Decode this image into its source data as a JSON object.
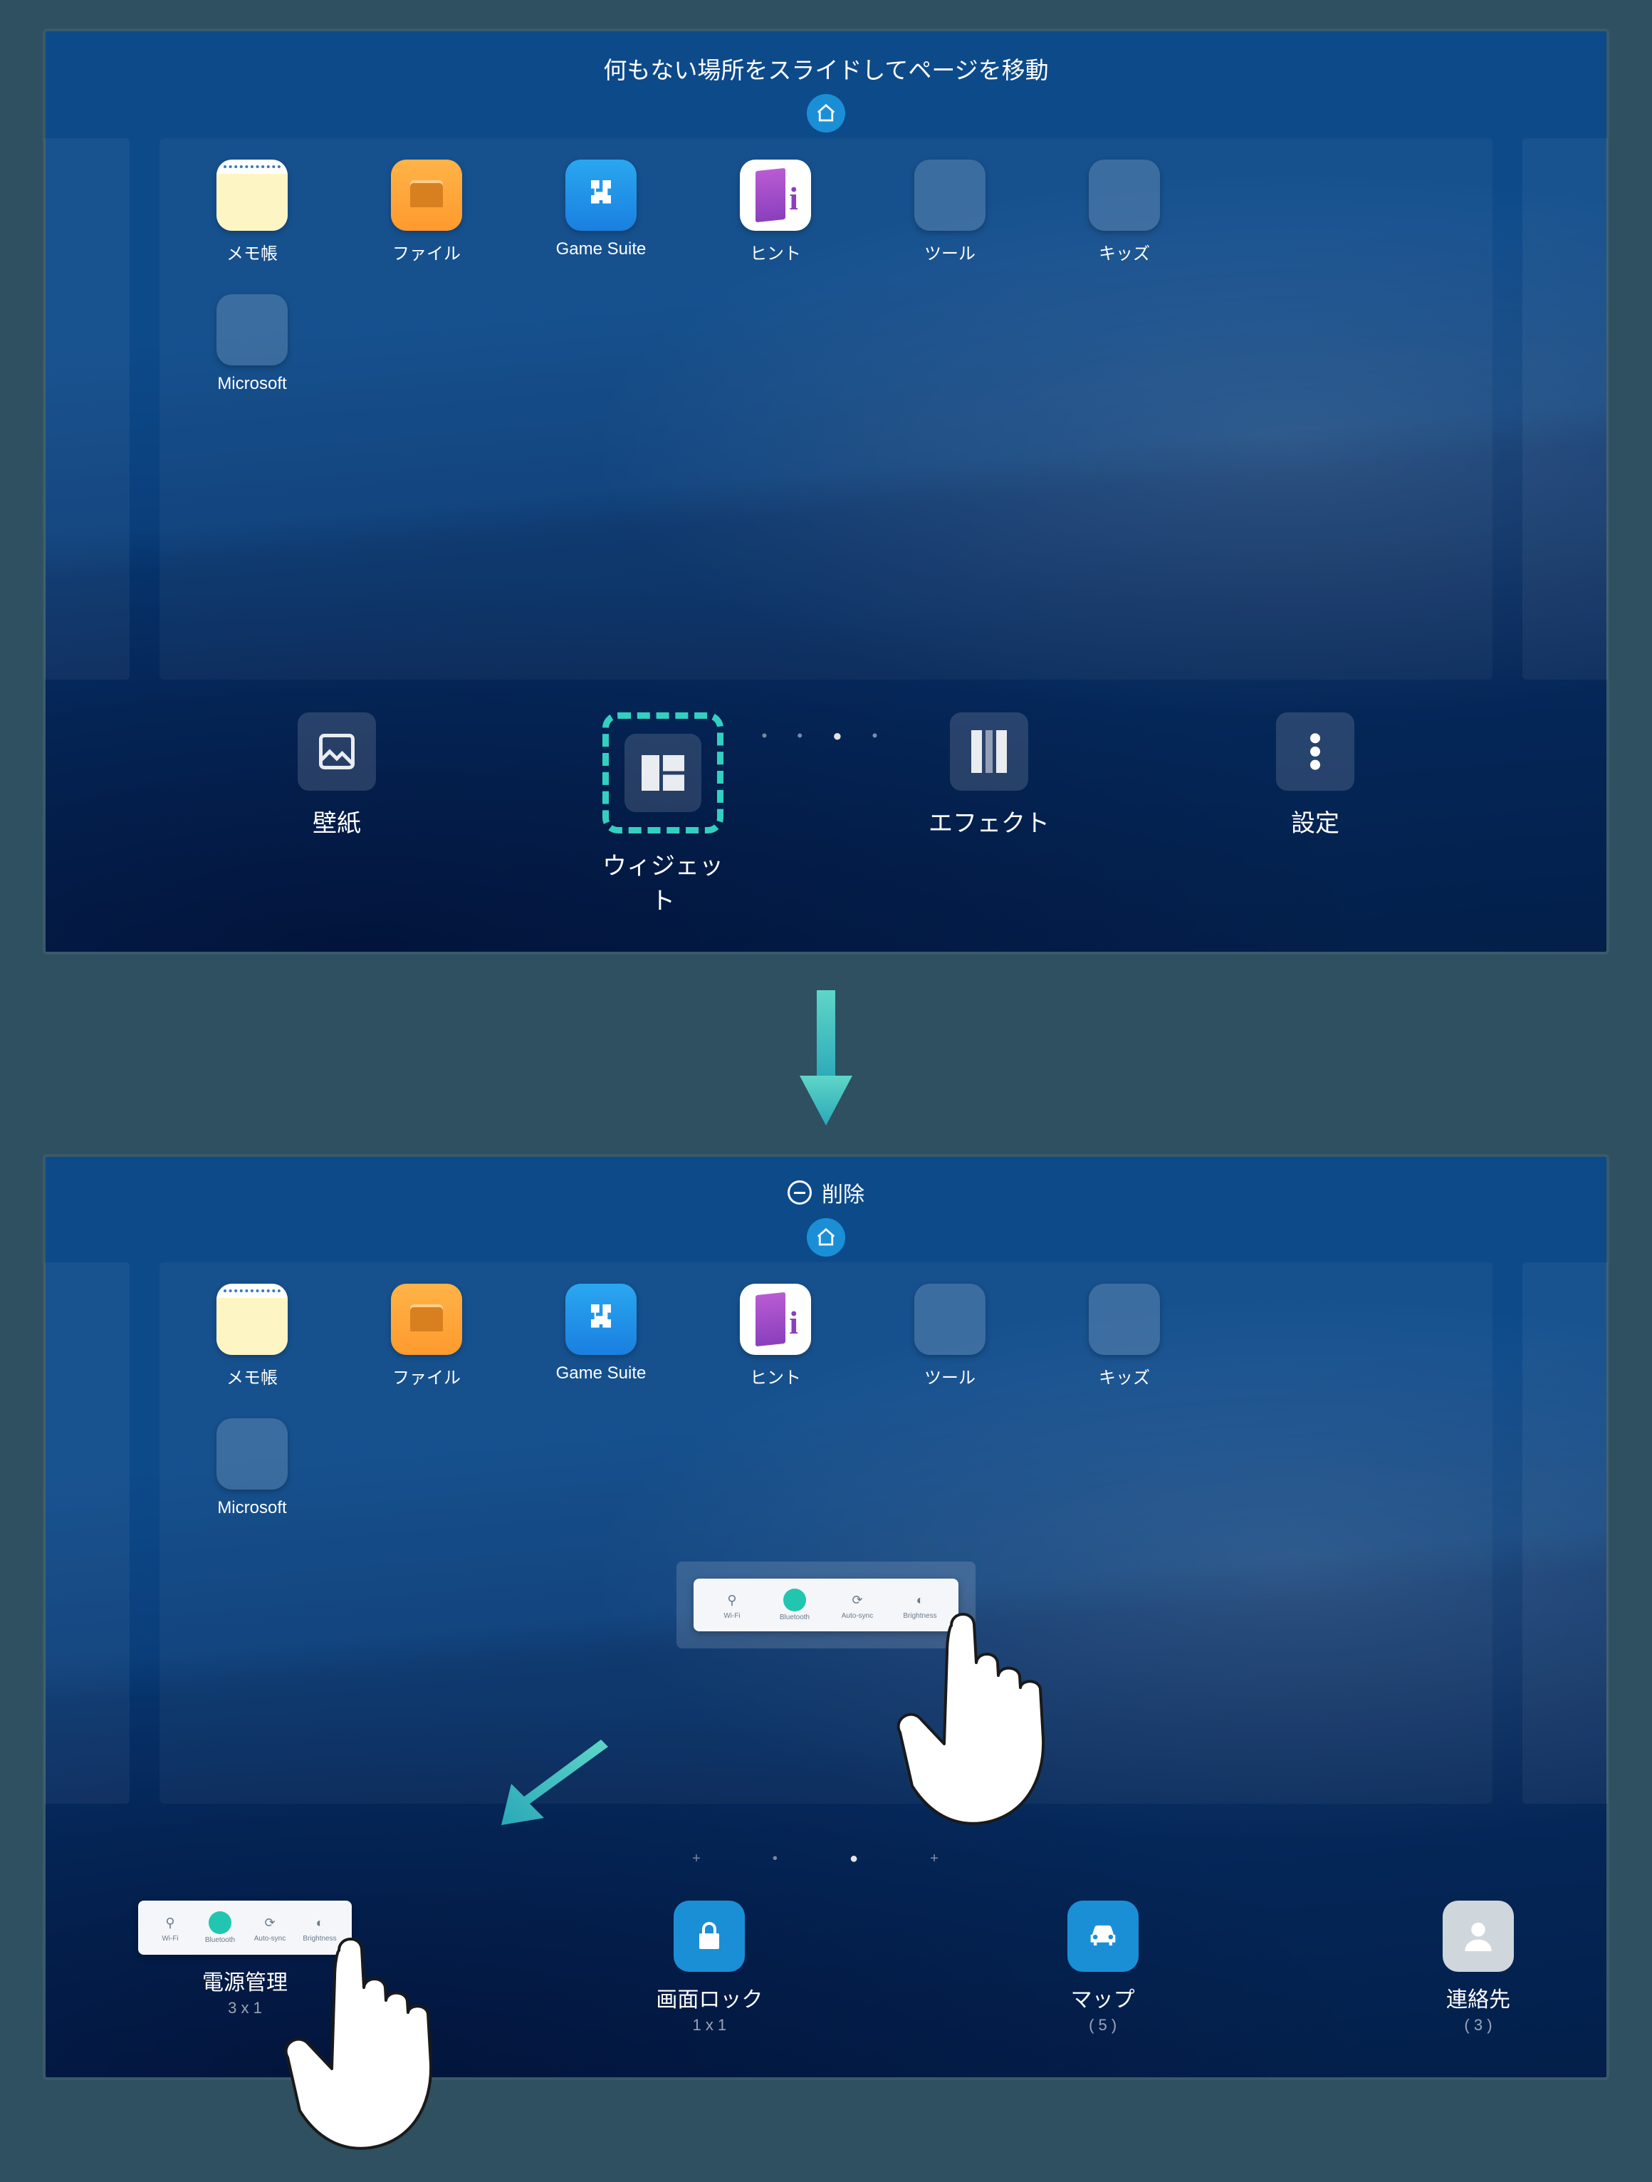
{
  "screen1": {
    "instruction": "何もない場所をスライドしてページを移動",
    "apps": [
      {
        "label": "メモ帳"
      },
      {
        "label": "ファイル"
      },
      {
        "label": "Game Suite"
      },
      {
        "label": "ヒント"
      },
      {
        "label": "ツール"
      },
      {
        "label": "キッズ"
      },
      {
        "label": "Microsoft"
      }
    ],
    "editors": [
      {
        "label": "壁紙"
      },
      {
        "label": "ウィジェット"
      },
      {
        "label": "エフェクト"
      },
      {
        "label": "設定"
      }
    ]
  },
  "screen2": {
    "delete_label": "削除",
    "apps": [
      {
        "label": "メモ帳"
      },
      {
        "label": "ファイル"
      },
      {
        "label": "Game Suite"
      },
      {
        "label": "ヒント"
      },
      {
        "label": "ツール"
      },
      {
        "label": "キッズ"
      },
      {
        "label": "Microsoft"
      }
    ],
    "power_toggles": [
      {
        "label": "Wi-Fi"
      },
      {
        "label": "Bluetooth"
      },
      {
        "label": "Auto-sync"
      },
      {
        "label": "Brightness"
      }
    ],
    "widgets": [
      {
        "title": "電源管理",
        "sub": "3 x 1"
      },
      {
        "title": "画面ロック",
        "sub": "1 x 1"
      },
      {
        "title": "マップ",
        "sub": "( 5 )"
      },
      {
        "title": "連絡先",
        "sub": "( 3 )"
      }
    ]
  }
}
